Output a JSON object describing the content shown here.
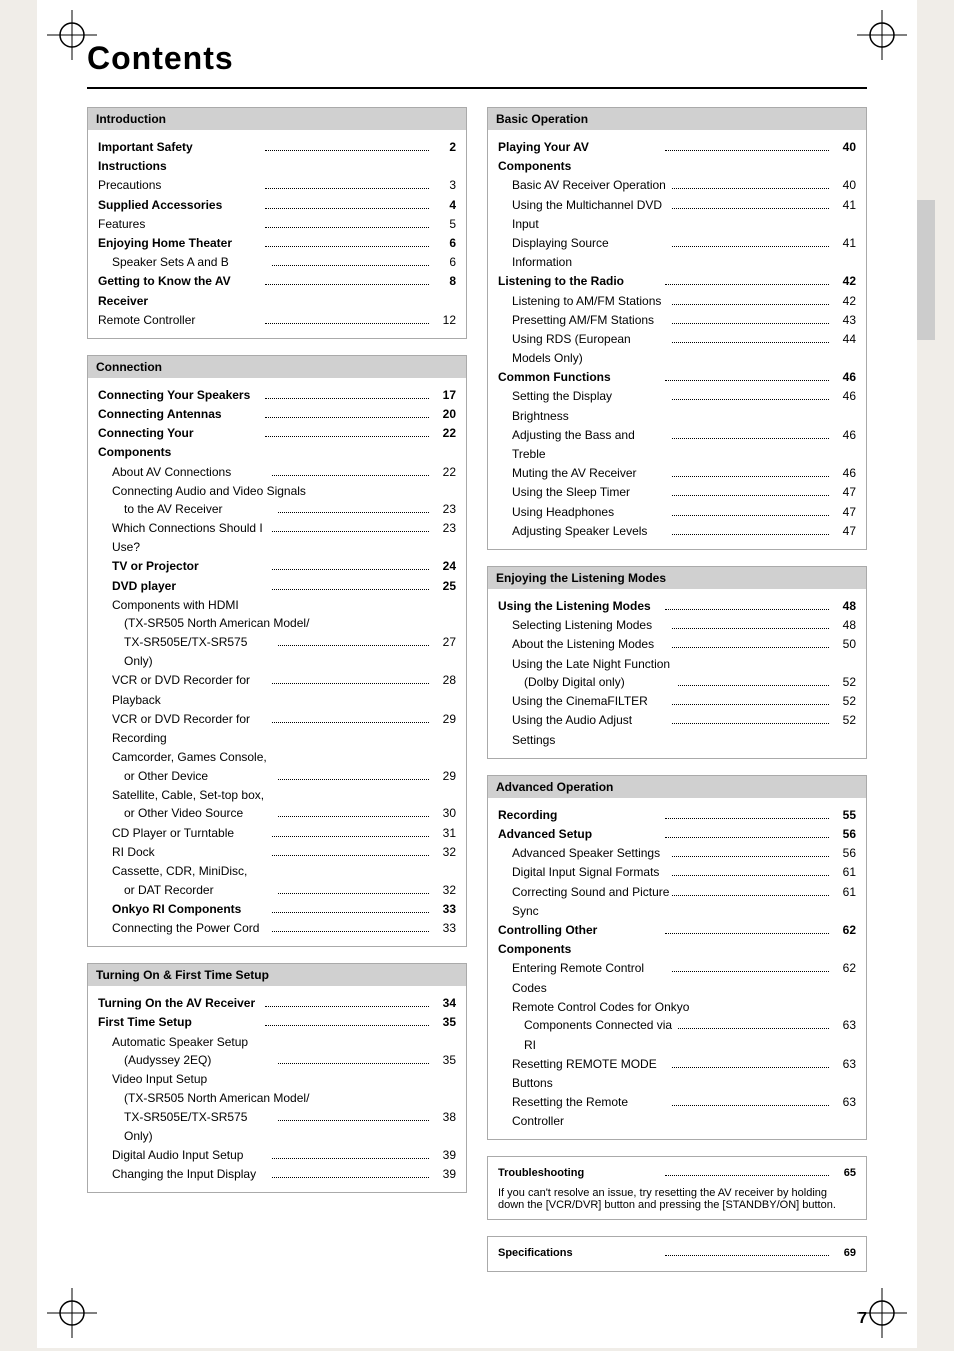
{
  "page": {
    "title": "Contents",
    "page_number": "7"
  },
  "left_column": {
    "sections": [
      {
        "id": "introduction",
        "header": "Introduction",
        "entries": [
          {
            "label": "Important Safety Instructions",
            "dots": true,
            "page": "2",
            "bold": true,
            "indent": 0
          },
          {
            "label": "Precautions",
            "dots": true,
            "page": "3",
            "bold": false,
            "indent": 0
          },
          {
            "label": "Supplied Accessories",
            "dots": true,
            "page": "4",
            "bold": true,
            "indent": 0
          },
          {
            "label": "Features",
            "dots": true,
            "page": "5",
            "bold": false,
            "indent": 0
          },
          {
            "label": "Enjoying Home Theater",
            "dots": true,
            "page": "6",
            "bold": true,
            "indent": 0
          },
          {
            "label": "Speaker Sets A and B",
            "dots": true,
            "page": "6",
            "bold": false,
            "indent": 1
          },
          {
            "label": "Getting to Know the AV Receiver",
            "dots": true,
            "page": "8",
            "bold": true,
            "indent": 0
          },
          {
            "label": "Remote Controller",
            "dots": true,
            "page": "12",
            "bold": false,
            "indent": 0
          }
        ]
      },
      {
        "id": "connection",
        "header": "Connection",
        "entries": [
          {
            "label": "Connecting Your Speakers",
            "dots": true,
            "page": "17",
            "bold": true,
            "indent": 0
          },
          {
            "label": "Connecting Antennas",
            "dots": true,
            "page": "20",
            "bold": true,
            "indent": 0
          },
          {
            "label": "Connecting Your Components",
            "dots": true,
            "page": "22",
            "bold": true,
            "indent": 0
          },
          {
            "label": "About AV Connections",
            "dots": true,
            "page": "22",
            "bold": false,
            "indent": 1
          },
          {
            "label": "Connecting Audio and Video Signals",
            "dots": false,
            "page": "",
            "bold": false,
            "indent": 1
          },
          {
            "label": "to the AV Receiver",
            "dots": true,
            "page": "23",
            "bold": false,
            "indent": 2
          },
          {
            "label": "Which Connections Should I Use?",
            "dots": true,
            "page": "23",
            "bold": false,
            "indent": 1
          },
          {
            "label": "TV or Projector",
            "dots": true,
            "page": "24",
            "bold": true,
            "indent": 1
          },
          {
            "label": "DVD player",
            "dots": true,
            "page": "25",
            "bold": true,
            "indent": 1
          },
          {
            "label": "Components with HDMI",
            "dots": false,
            "page": "",
            "bold": false,
            "indent": 1
          },
          {
            "label": "(TX-SR505 North American Model/",
            "dots": false,
            "page": "",
            "bold": false,
            "indent": 2
          },
          {
            "label": "TX-SR505E/TX-SR575 Only)",
            "dots": true,
            "page": "27",
            "bold": false,
            "indent": 2
          },
          {
            "label": "VCR or DVD Recorder for Playback",
            "dots": true,
            "page": "28",
            "bold": false,
            "indent": 1
          },
          {
            "label": "VCR or DVD Recorder for Recording",
            "dots": true,
            "page": "29",
            "bold": false,
            "indent": 1
          },
          {
            "label": "Camcorder, Games Console,",
            "dots": false,
            "page": "",
            "bold": false,
            "indent": 1
          },
          {
            "label": "or Other Device",
            "dots": true,
            "page": "29",
            "bold": false,
            "indent": 2
          },
          {
            "label": "Satellite, Cable, Set-top box,",
            "dots": false,
            "page": "",
            "bold": false,
            "indent": 1
          },
          {
            "label": "or Other Video Source",
            "dots": true,
            "page": "30",
            "bold": false,
            "indent": 2
          },
          {
            "label": "CD Player or Turntable",
            "dots": true,
            "page": "31",
            "bold": false,
            "indent": 1
          },
          {
            "label": "RI Dock",
            "dots": true,
            "page": "32",
            "bold": false,
            "indent": 1
          },
          {
            "label": "Cassette, CDR, MiniDisc,",
            "dots": false,
            "page": "",
            "bold": false,
            "indent": 1
          },
          {
            "label": "or DAT Recorder",
            "dots": true,
            "page": "32",
            "bold": false,
            "indent": 2
          },
          {
            "label": "Onkyo RI Components",
            "dots": true,
            "page": "33",
            "bold": true,
            "indent": 1
          },
          {
            "label": "Connecting the Power Cord",
            "dots": true,
            "page": "33",
            "bold": false,
            "indent": 1
          }
        ]
      },
      {
        "id": "turning-on",
        "header": "Turning On & First Time Setup",
        "entries": [
          {
            "label": "Turning On the AV Receiver",
            "dots": true,
            "page": "34",
            "bold": true,
            "indent": 0
          },
          {
            "label": "First Time Setup",
            "dots": true,
            "page": "35",
            "bold": true,
            "indent": 0
          },
          {
            "label": "Automatic Speaker Setup",
            "dots": false,
            "page": "",
            "bold": false,
            "indent": 1
          },
          {
            "label": "(Audyssey 2EQ)",
            "dots": true,
            "page": "35",
            "bold": false,
            "indent": 2
          },
          {
            "label": "Video Input Setup",
            "dots": false,
            "page": "",
            "bold": false,
            "indent": 1
          },
          {
            "label": "(TX-SR505 North American Model/",
            "dots": false,
            "page": "",
            "bold": false,
            "indent": 2
          },
          {
            "label": "TX-SR505E/TX-SR575 Only)",
            "dots": true,
            "page": "38",
            "bold": false,
            "indent": 2
          },
          {
            "label": "Digital Audio Input Setup",
            "dots": true,
            "page": "39",
            "bold": false,
            "indent": 1
          },
          {
            "label": "Changing the Input Display",
            "dots": true,
            "page": "39",
            "bold": false,
            "indent": 1
          }
        ]
      }
    ]
  },
  "right_column": {
    "sections": [
      {
        "id": "basic-operation",
        "header": "Basic Operation",
        "entries": [
          {
            "label": "Playing Your AV Components",
            "dots": true,
            "page": "40",
            "bold": true,
            "indent": 0
          },
          {
            "label": "Basic AV Receiver Operation",
            "dots": true,
            "page": "40",
            "bold": false,
            "indent": 1
          },
          {
            "label": "Using the Multichannel DVD Input",
            "dots": true,
            "page": "41",
            "bold": false,
            "indent": 1
          },
          {
            "label": "Displaying Source Information",
            "dots": true,
            "page": "41",
            "bold": false,
            "indent": 1
          },
          {
            "label": "Listening to the Radio",
            "dots": true,
            "page": "42",
            "bold": true,
            "indent": 0
          },
          {
            "label": "Listening to AM/FM Stations",
            "dots": true,
            "page": "42",
            "bold": false,
            "indent": 1
          },
          {
            "label": "Presetting AM/FM Stations",
            "dots": true,
            "page": "43",
            "bold": false,
            "indent": 1
          },
          {
            "label": "Using RDS (European Models Only)",
            "dots": true,
            "page": "44",
            "bold": false,
            "indent": 1
          },
          {
            "label": "Common Functions",
            "dots": true,
            "page": "46",
            "bold": true,
            "indent": 0
          },
          {
            "label": "Setting the Display Brightness",
            "dots": true,
            "page": "46",
            "bold": false,
            "indent": 1
          },
          {
            "label": "Adjusting the Bass and Treble",
            "dots": true,
            "page": "46",
            "bold": false,
            "indent": 1
          },
          {
            "label": "Muting the AV Receiver",
            "dots": true,
            "page": "46",
            "bold": false,
            "indent": 1
          },
          {
            "label": "Using the Sleep Timer",
            "dots": true,
            "page": "47",
            "bold": false,
            "indent": 1
          },
          {
            "label": "Using Headphones",
            "dots": true,
            "page": "47",
            "bold": false,
            "indent": 1
          },
          {
            "label": "Adjusting Speaker Levels",
            "dots": true,
            "page": "47",
            "bold": false,
            "indent": 1
          }
        ]
      },
      {
        "id": "listening-modes",
        "header": "Enjoying the Listening Modes",
        "entries": [
          {
            "label": "Using the Listening Modes",
            "dots": true,
            "page": "48",
            "bold": true,
            "indent": 0
          },
          {
            "label": "Selecting Listening Modes",
            "dots": true,
            "page": "48",
            "bold": false,
            "indent": 1
          },
          {
            "label": "About the Listening Modes",
            "dots": true,
            "page": "50",
            "bold": false,
            "indent": 1
          },
          {
            "label": "Using the Late Night Function",
            "dots": false,
            "page": "",
            "bold": false,
            "indent": 1
          },
          {
            "label": "(Dolby Digital only)",
            "dots": true,
            "page": "52",
            "bold": false,
            "indent": 2
          },
          {
            "label": "Using the CinemaFILTER",
            "dots": true,
            "page": "52",
            "bold": false,
            "indent": 1
          },
          {
            "label": "Using the Audio Adjust Settings",
            "dots": true,
            "page": "52",
            "bold": false,
            "indent": 1
          }
        ]
      },
      {
        "id": "advanced-operation",
        "header": "Advanced Operation",
        "entries": [
          {
            "label": "Recording",
            "dots": true,
            "page": "55",
            "bold": true,
            "indent": 0
          },
          {
            "label": "Advanced Setup",
            "dots": true,
            "page": "56",
            "bold": true,
            "indent": 0
          },
          {
            "label": "Advanced Speaker Settings",
            "dots": true,
            "page": "56",
            "bold": false,
            "indent": 1
          },
          {
            "label": "Digital Input Signal Formats",
            "dots": true,
            "page": "61",
            "bold": false,
            "indent": 1
          },
          {
            "label": "Correcting Sound and Picture Sync",
            "dots": true,
            "page": "61",
            "bold": false,
            "indent": 1
          },
          {
            "label": "Controlling Other Components",
            "dots": true,
            "page": "62",
            "bold": true,
            "indent": 0
          },
          {
            "label": "Entering Remote Control Codes",
            "dots": true,
            "page": "62",
            "bold": false,
            "indent": 1
          },
          {
            "label": "Remote Control Codes for Onkyo",
            "dots": false,
            "page": "",
            "bold": false,
            "indent": 1
          },
          {
            "label": "Components Connected via RI",
            "dots": true,
            "page": "63",
            "bold": false,
            "indent": 2
          },
          {
            "label": "Resetting REMOTE MODE Buttons",
            "dots": true,
            "page": "63",
            "bold": false,
            "indent": 1
          },
          {
            "label": "Resetting the Remote Controller",
            "dots": true,
            "page": "63",
            "bold": false,
            "indent": 1
          }
        ]
      }
    ],
    "troubleshooting": {
      "label": "Troubleshooting",
      "page": "65",
      "note": "If you can't resolve an issue, try resetting the AV receiver by holding down the [VCR/DVR] button and pressing the [STANDBY/ON] button."
    },
    "specifications": {
      "label": "Specifications",
      "page": "69"
    }
  }
}
